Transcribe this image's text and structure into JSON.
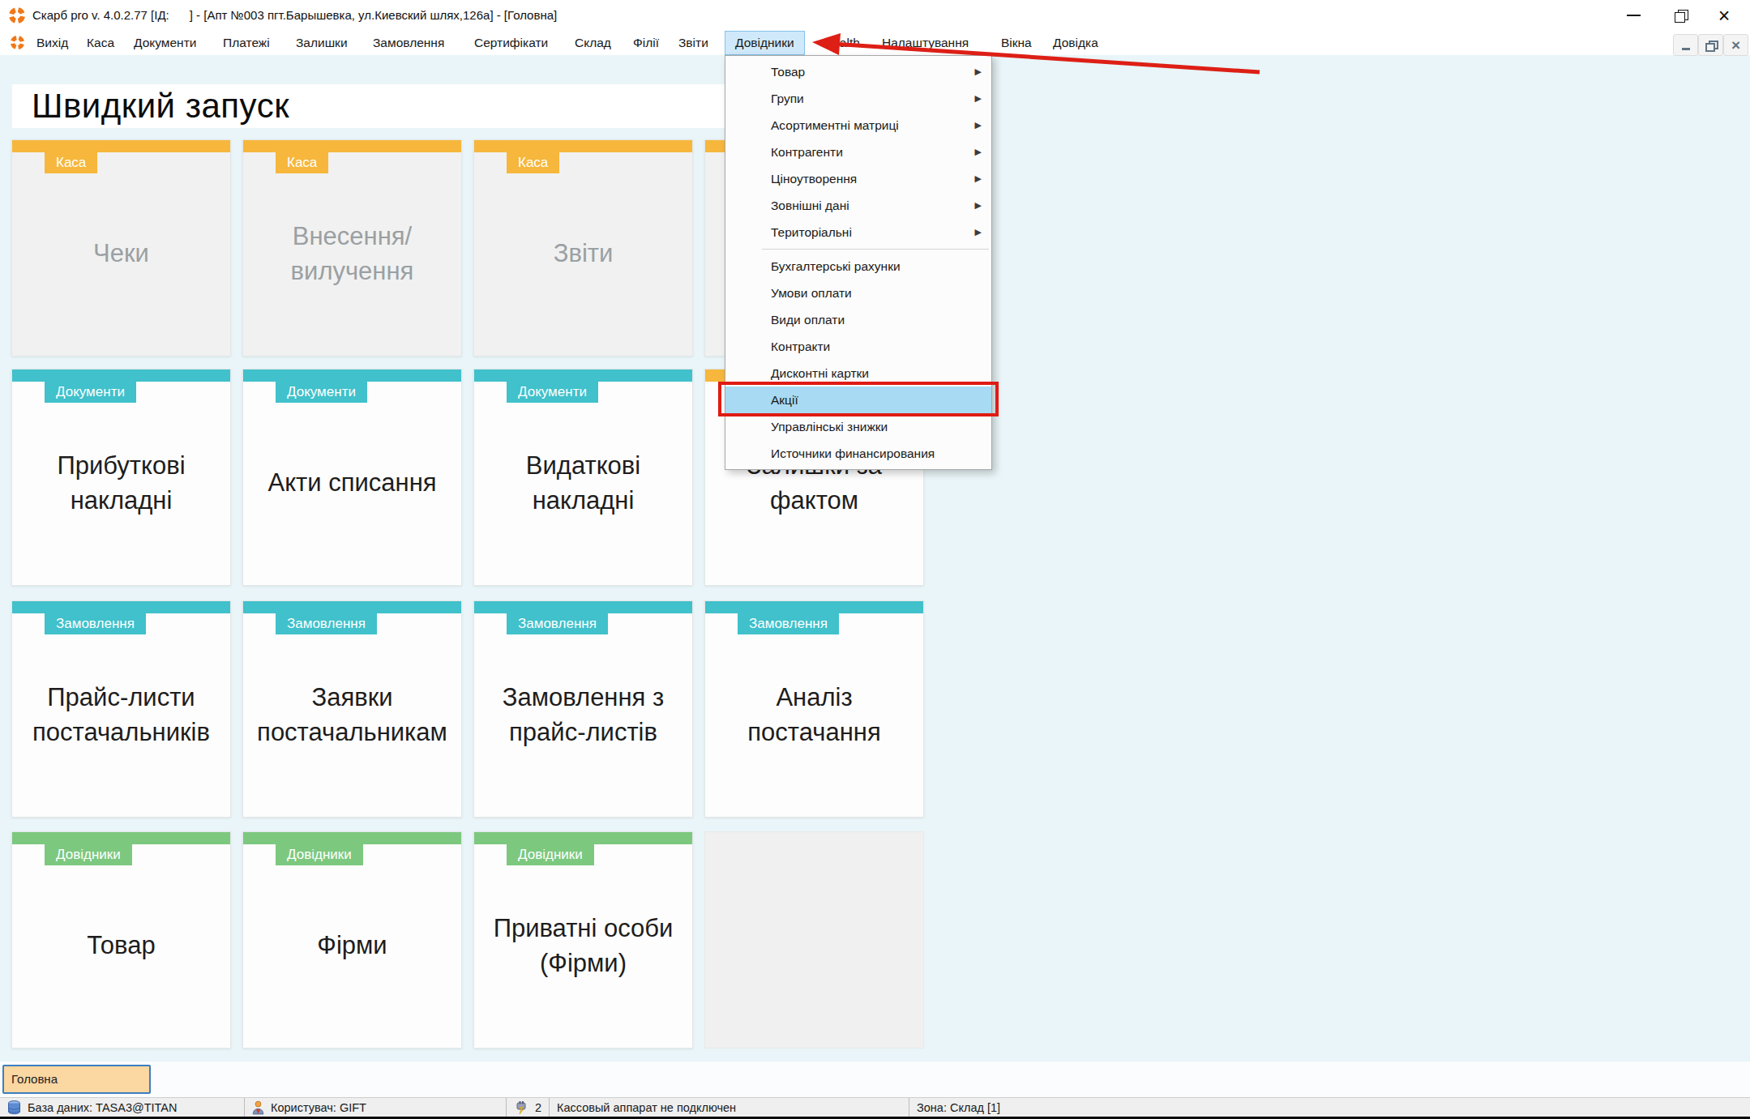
{
  "window": {
    "title": "Скарб pro v. 4.0.2.77 [ІД:      ] - [Апт №003 пгт.Барышевка, ул.Киевский шлях,126а] - [Головна]"
  },
  "icons": {
    "submenu_arrow": "▶",
    "window_close": "×",
    "mdi_close": "×",
    "app_logo": "orange-segmented-ring",
    "database": "blue-cylinder",
    "user": "person",
    "cash_connection": "plug-lightning"
  },
  "menu_bar": {
    "items": [
      {
        "label": "Вихід"
      },
      {
        "label": "Каса"
      },
      {
        "label": "Документи"
      },
      {
        "label": "Платежі"
      },
      {
        "label": "Залишки"
      },
      {
        "label": "Замовлення"
      },
      {
        "label": "Сертифікати"
      },
      {
        "label": "Склад"
      },
      {
        "label": "Філії"
      },
      {
        "label": "Звіти"
      },
      {
        "label": "Довідники",
        "highlighted": true
      },
      {
        "label": "Health"
      },
      {
        "label": "Налаштування"
      },
      {
        "label": "Вікна"
      },
      {
        "label": "Довідка"
      }
    ]
  },
  "dropdown": {
    "items": [
      {
        "label": "Товар",
        "submenu": true
      },
      {
        "label": "Групи",
        "submenu": true
      },
      {
        "label": "Асортиментні матриці",
        "submenu": true
      },
      {
        "label": "Контрагенти",
        "submenu": true
      },
      {
        "label": "Ціноутворення",
        "submenu": true
      },
      {
        "label": "Зовнішні дані",
        "submenu": true
      },
      {
        "label": "Територіальні",
        "submenu": true
      },
      {
        "label": "Бухгалтерські рахунки",
        "submenu": false
      },
      {
        "label": "Умови оплати",
        "submenu": false
      },
      {
        "label": "Види оплати",
        "submenu": false
      },
      {
        "label": "Контракти",
        "submenu": false
      },
      {
        "label": "Дисконтні картки",
        "submenu": false
      },
      {
        "label": "Акції",
        "submenu": false,
        "highlighted": true,
        "annotated": true
      },
      {
        "label": "Управлінські знижки",
        "submenu": false
      },
      {
        "label": "Источники финансирования",
        "submenu": false
      }
    ]
  },
  "quick_launch": {
    "heading": "Швидкий запуск",
    "rows": [
      {
        "tiles": [
          {
            "category": "Каса",
            "label": "Чеки"
          },
          {
            "category": "Каса",
            "label": "Внесення/вилучення"
          },
          {
            "category": "Каса",
            "label": "Звіти"
          },
          {
            "category": "",
            "label": ""
          }
        ]
      },
      {
        "tiles": [
          {
            "category": "Документи",
            "label": "Прибуткові накладні"
          },
          {
            "category": "Документи",
            "label": "Акти списання"
          },
          {
            "category": "Документи",
            "label": "Видаткові накладні"
          },
          {
            "category": "",
            "label": "Залишки за фактом"
          }
        ]
      },
      {
        "tiles": [
          {
            "category": "Замовлення",
            "label": "Прайс-листи постачальників"
          },
          {
            "category": "Замовлення",
            "label": "Заявки постачальникам"
          },
          {
            "category": "Замовлення",
            "label": "Замовлення з прайс-листів"
          },
          {
            "category": "Замовлення",
            "label": "Аналіз постачання"
          }
        ]
      },
      {
        "tiles": [
          {
            "category": "Довідники",
            "label": "Товар"
          },
          {
            "category": "Довідники",
            "label": "Фірми"
          },
          {
            "category": "Довідники",
            "label": "Приватні особи (Фірми)"
          },
          {
            "category": "",
            "label": ""
          }
        ]
      }
    ]
  },
  "footer": {
    "tab": "Головна",
    "status": {
      "database": "База даних: TASA3@TITAN",
      "user": "Користувач: GIFT",
      "counter": "2",
      "cash": "Кассовый аппарат не подключен",
      "zone": "Зона: Склад [1]"
    }
  },
  "colors": {
    "accent_amber": "#f6b73c",
    "accent_teal": "#40c1cb",
    "accent_green": "#7cc87f",
    "menu_highlight": "#cfe9fb",
    "item_highlight": "#a8dbf3",
    "annotation_red": "#e01b14",
    "page_bg": "#e9f5f8"
  }
}
